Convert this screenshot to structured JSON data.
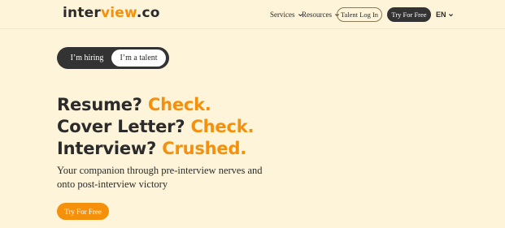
{
  "brand": {
    "logo_part1": "inter",
    "logo_part2": "view",
    "logo_part3": ".co"
  },
  "nav": {
    "services_label": "Services",
    "resources_label": "Resources",
    "talent_login_label": "Talent Log In",
    "try_free_label": "Try For Free",
    "language_label": "EN"
  },
  "toggle": {
    "hiring_label": "I’m hiring",
    "talent_label": "I’m a talent",
    "selected": "I’m a talent"
  },
  "hero": {
    "line1_text": "Resume?",
    "line1_accent": "Check.",
    "line2_text": "Cover Letter?",
    "line2_accent": "Check.",
    "line3_text": "Interview?",
    "line3_accent": "Crushed.",
    "subtitle": "Your companion through pre-interview nerves and onto post-interview victory",
    "cta_label": "Try For Free"
  },
  "colors": {
    "accent": "#f4900c",
    "background": "#fef4d9",
    "dark": "#333333"
  }
}
